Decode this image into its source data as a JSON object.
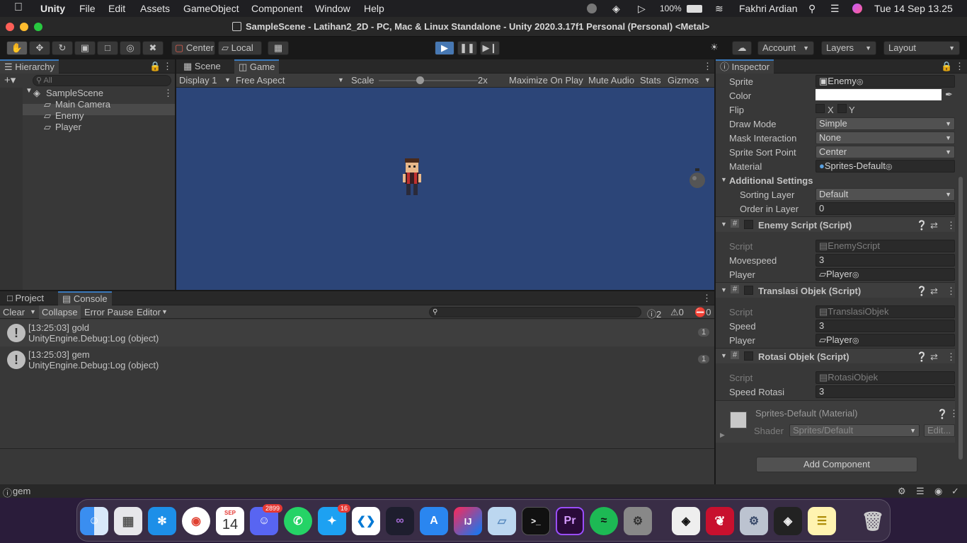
{
  "menubar": {
    "app": "Unity",
    "items": [
      "File",
      "Edit",
      "Assets",
      "GameObject",
      "Component",
      "Window",
      "Help"
    ],
    "battery": "100%",
    "user": "Fakhri Ardian",
    "datetime": "Tue 14 Sep  13.25"
  },
  "window": {
    "title": "SampleScene - Latihan2_2D - PC, Mac & Linux Standalone - Unity 2020.3.17f1 Personal (Personal) <Metal>"
  },
  "toolbar": {
    "pivot": "Center",
    "space": "Local",
    "account": "Account",
    "layers": "Layers",
    "layout": "Layout"
  },
  "hierarchy": {
    "tab": "Hierarchy",
    "search_placeholder": "All",
    "scene": "SampleScene",
    "objects": [
      "Main Camera",
      "Enemy",
      "Player"
    ]
  },
  "game": {
    "tab_scene": "Scene",
    "tab_game": "Game",
    "display": "Display 1",
    "aspect": "Free Aspect",
    "scale_label": "Scale",
    "scale_value": "2x",
    "maximize": "Maximize On Play",
    "mute": "Mute Audio",
    "stats": "Stats",
    "gizmos": "Gizmos",
    "bg_color": "#2c4578"
  },
  "console": {
    "tab_project": "Project",
    "tab_console": "Console",
    "clear": "Clear",
    "collapse": "Collapse",
    "error_pause": "Error Pause",
    "editor": "Editor",
    "count_log": "2",
    "count_warn": "0",
    "count_err": "0",
    "entries": [
      {
        "line1": "[13:25:03] gold",
        "line2": "UnityEngine.Debug:Log (object)",
        "count": "1"
      },
      {
        "line1": "[13:25:03] gem",
        "line2": "UnityEngine.Debug:Log (object)",
        "count": "1"
      }
    ]
  },
  "status": {
    "text": "gem"
  },
  "inspector": {
    "tab": "Inspector",
    "rows": [
      {
        "label": "Sprite",
        "value": "Enemy"
      },
      {
        "label": "Color",
        "value": ""
      },
      {
        "label": "Flip",
        "x": "X",
        "y": "Y"
      },
      {
        "label": "Draw Mode",
        "value": "Simple"
      },
      {
        "label": "Mask Interaction",
        "value": "None"
      },
      {
        "label": "Sprite Sort Point",
        "value": "Center"
      },
      {
        "label": "Material",
        "value": "Sprites-Default"
      }
    ],
    "additional": {
      "title": "Additional Settings",
      "sorting_label": "Sorting Layer",
      "sorting_value": "Default",
      "order_label": "Order in Layer",
      "order_value": "0"
    },
    "enemy": {
      "title": "Enemy Script (Script)",
      "script_label": "Script",
      "script_value": "EnemyScript",
      "speed_label": "Movespeed",
      "speed_value": "3",
      "player_label": "Player",
      "player_value": "Player"
    },
    "translasi": {
      "title": "Translasi Objek (Script)",
      "script_label": "Script",
      "script_value": "TranslasiObjek",
      "speed_label": "Speed",
      "speed_value": "3",
      "player_label": "Player",
      "player_value": "Player"
    },
    "rotasi": {
      "title": "Rotasi Objek (Script)",
      "script_label": "Script",
      "script_value": "RotasiObjek",
      "speed_label": "Speed Rotasi",
      "speed_value": "3"
    },
    "material": {
      "name": "Sprites-Default (Material)",
      "shader_label": "Shader",
      "shader_value": "Sprites/Default",
      "edit": "Edit..."
    },
    "add_component": "Add Component"
  },
  "dock": {
    "calendar_month": "SEP",
    "calendar_day": "14",
    "discord_badge": "2899",
    "twitter_badge": "16"
  }
}
